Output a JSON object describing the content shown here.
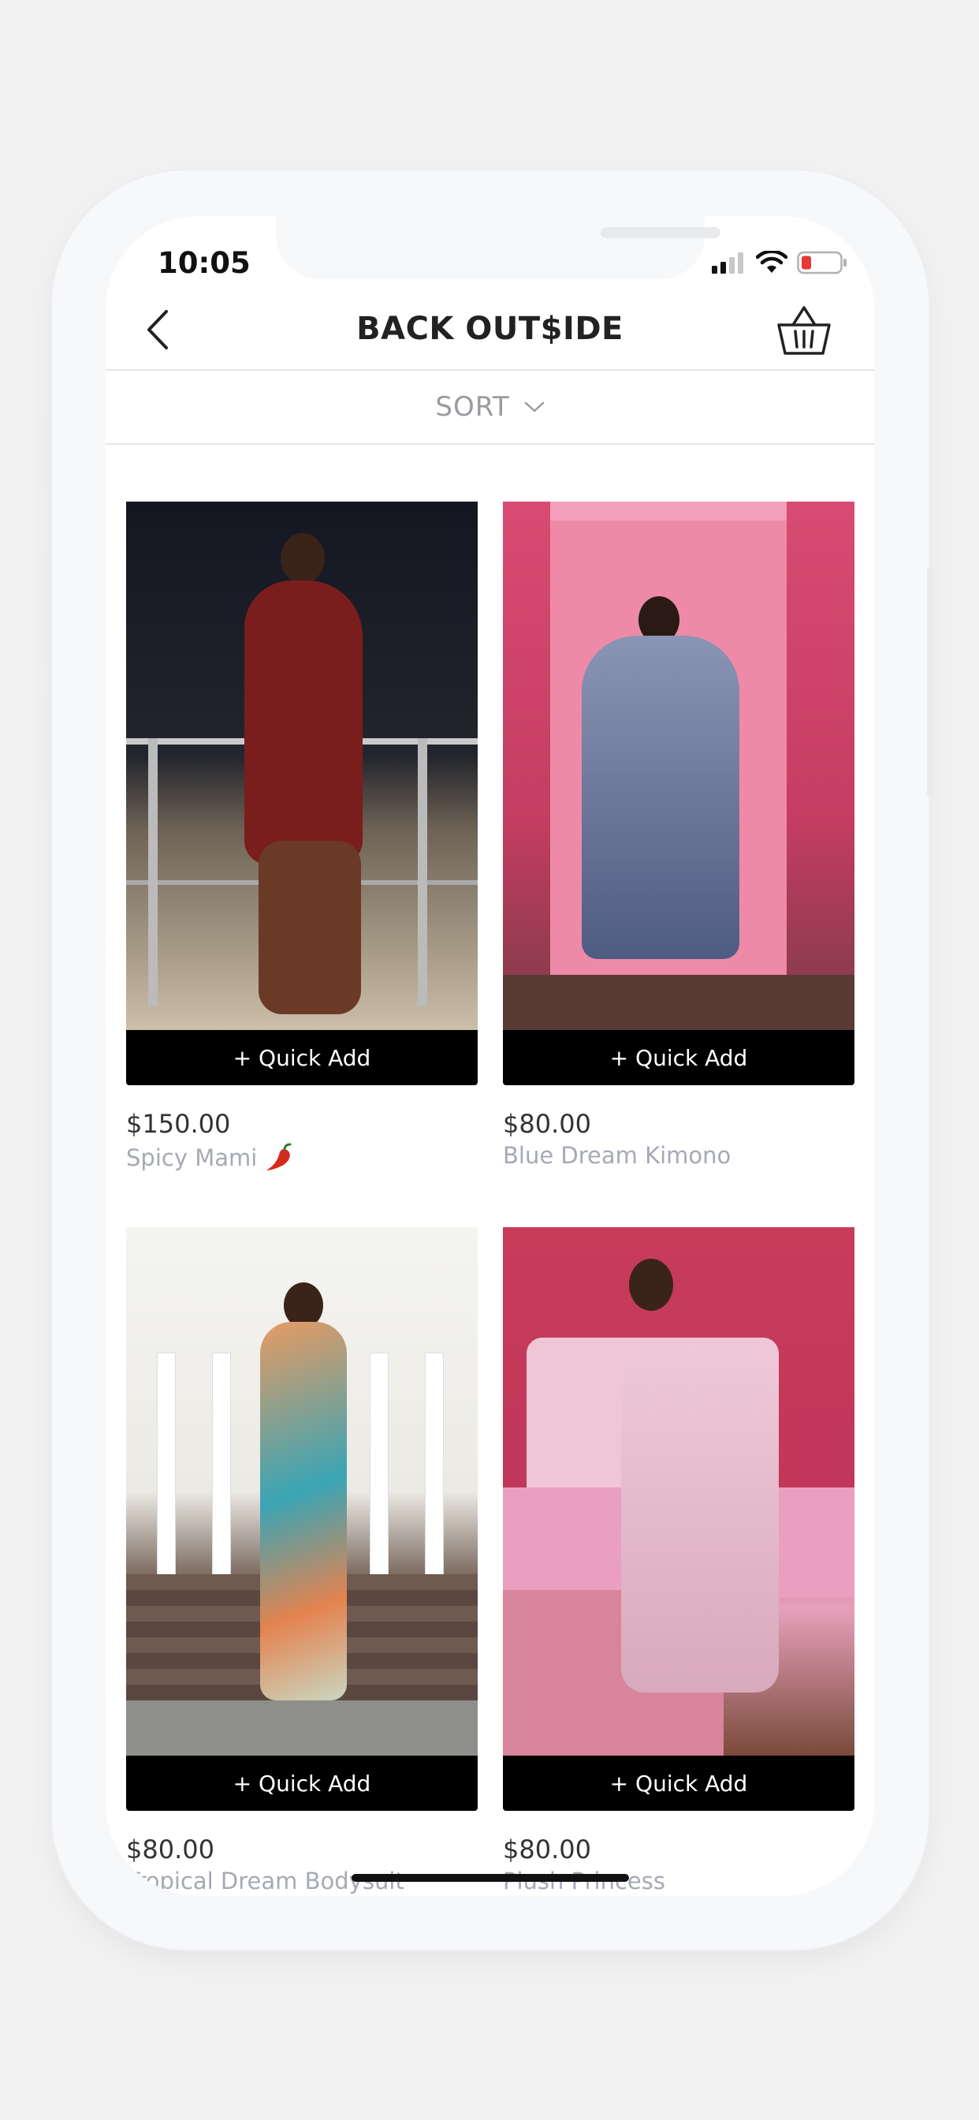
{
  "status_bar": {
    "time": "10:05",
    "icons": [
      "cellular-signal-icon",
      "wifi-icon",
      "battery-low-icon"
    ]
  },
  "header": {
    "title": "BACK OUT$IDE",
    "back_icon": "chevron-left-icon",
    "cart_icon": "basket-icon"
  },
  "sort": {
    "label": "SORT",
    "icon": "chevron-down-icon"
  },
  "products": [
    {
      "price": "$150.00",
      "name": "Spicy Mami",
      "badge_icon": "chili-pepper-icon",
      "quick_add_label": "+ Quick Add",
      "image_colors": [
        "#1b1a22",
        "#7a1d1d"
      ]
    },
    {
      "price": "$80.00",
      "name": "Blue Dream Kimono",
      "quick_add_label": "+ Quick Add",
      "image_colors": [
        "#d44a72",
        "#5f6d94"
      ]
    },
    {
      "price": "$80.00",
      "name": "Tropical Dream Bodysuit",
      "quick_add_label": "+ Quick Add",
      "image_colors": [
        "#f1f1ee",
        "#e79a62"
      ]
    },
    {
      "price": "$80.00",
      "name": "Plush Princess",
      "quick_add_label": "+ Quick Add",
      "image_colors": [
        "#c83b5b",
        "#ecc7d6"
      ]
    }
  ],
  "colors": {
    "quick_add_bg": "#000000",
    "product_name": "#a6a9b6",
    "price": "#333333"
  }
}
